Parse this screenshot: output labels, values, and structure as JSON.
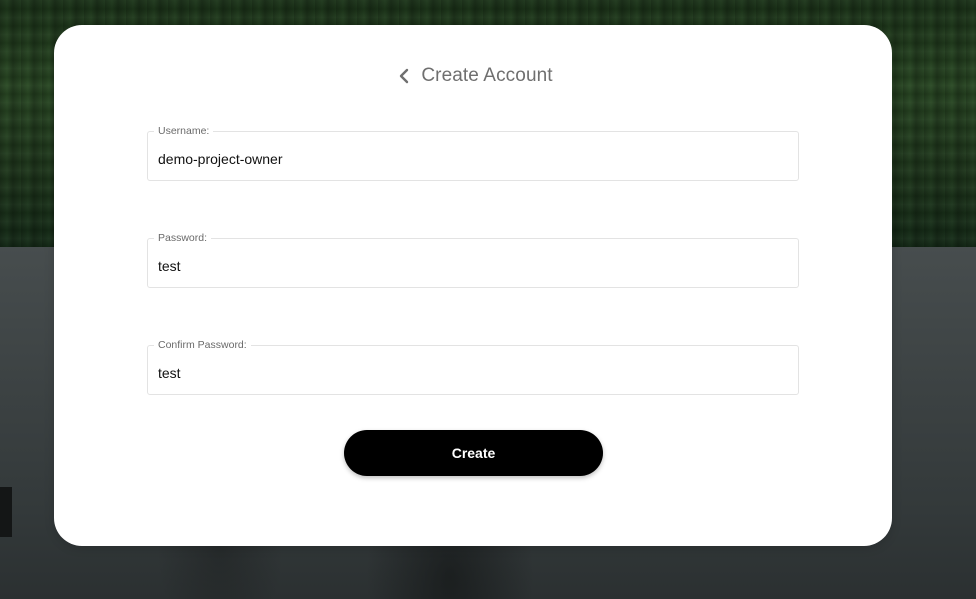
{
  "page": {
    "title": "Create Account",
    "back_icon": "chevron-left-icon"
  },
  "form": {
    "username": {
      "label": "Username:",
      "value": "demo-project-owner"
    },
    "password": {
      "label": "Password:",
      "value": "test"
    },
    "confirm_password": {
      "label": "Confirm Password:",
      "value": "test"
    },
    "submit_label": "Create"
  },
  "colors": {
    "card_background": "#ffffff",
    "button_background": "#000000",
    "button_text": "#ffffff",
    "title_text": "#6f6f6f",
    "field_border": "#e3e3e3"
  }
}
